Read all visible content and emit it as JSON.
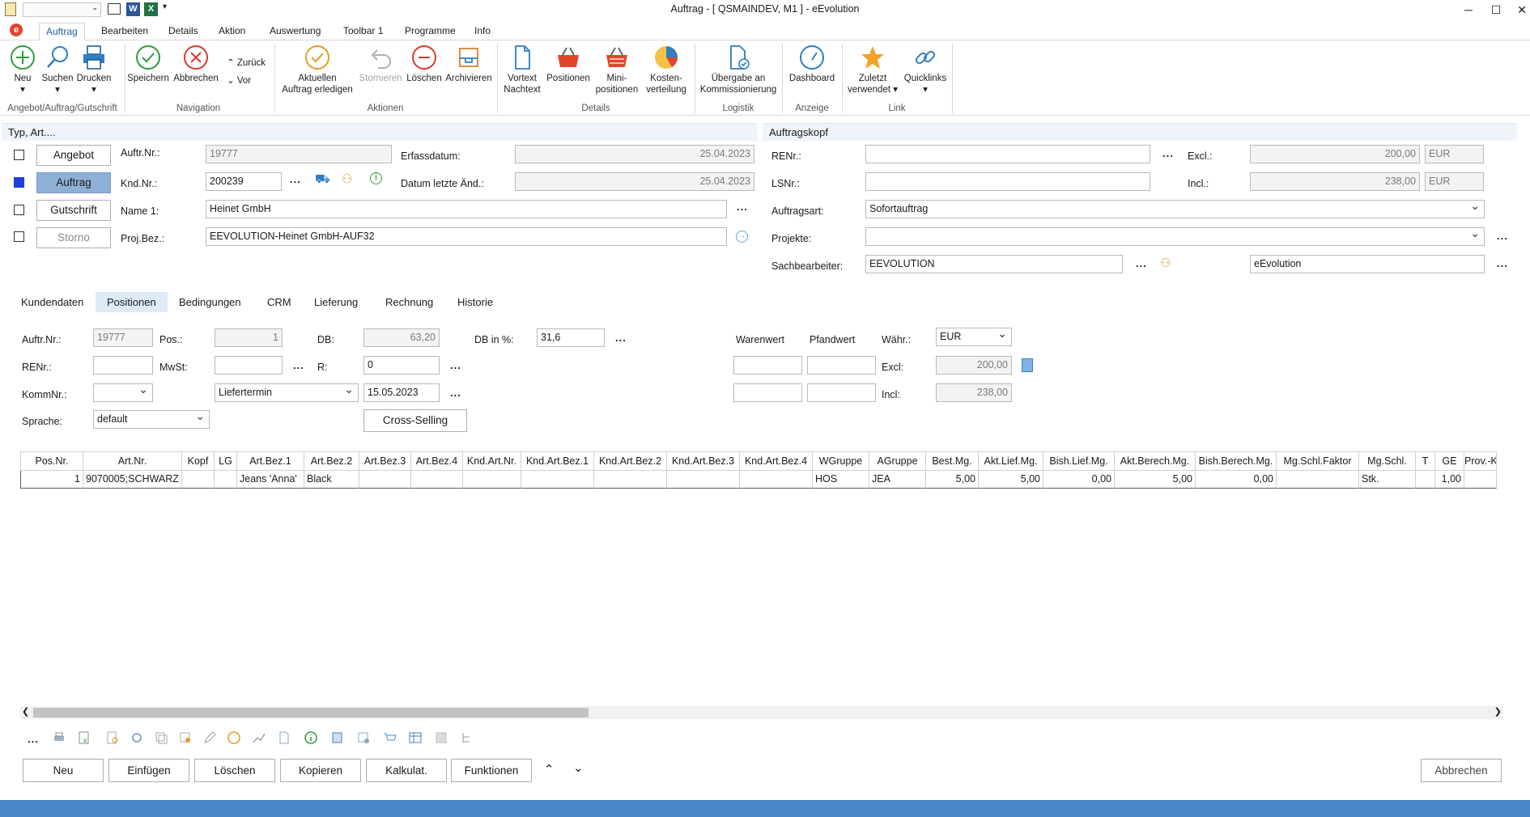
{
  "window": {
    "title": "Auftrag - [ QSMAINDEV, M1 ]  -  eEvolution",
    "minimize": "─",
    "maximize": "☐",
    "close": "✕"
  },
  "ribbon_tabs": [
    "Auftrag",
    "Bearbeiten",
    "Details",
    "Aktion",
    "Auswertung",
    "Toolbar 1",
    "Programme",
    "Info"
  ],
  "ribbon": {
    "neu": "Neu",
    "suchen": "Suchen",
    "drucken": "Drucken",
    "group_angebot": "Angebot/Auftrag/Gutschrift",
    "speichern": "Speichern",
    "abbrechen": "Abbrechen",
    "zurueck": "Zurück",
    "vor": "Vor",
    "group_navigation": "Navigation",
    "aktuellen_line1": "Aktuellen",
    "aktuellen_line2": "Auftrag erledigen",
    "stornieren": "Stornieren",
    "loeschen": "Löschen",
    "archivieren": "Archivieren",
    "group_aktionen": "Aktionen",
    "vortext_line1": "Vortext",
    "vortext_line2": "Nachtext",
    "positionen": "Positionen",
    "mini_line1": "Mini-",
    "mini_line2": "positionen",
    "kosten_line1": "Kosten-",
    "kosten_line2": "verteilung",
    "group_details": "Details",
    "uebergabe_line1": "Übergabe an",
    "uebergabe_line2": "Kommissionierung",
    "group_logistik": "Logistik",
    "dashboard": "Dashboard",
    "group_anzeige": "Anzeige",
    "zuletzt_line1": "Zuletzt",
    "zuletzt_line2": "verwendet",
    "quicklinks": "Quicklinks",
    "group_link": "Link"
  },
  "typ_section": {
    "header": "Typ, Art....",
    "angebot": "Angebot",
    "auftrag": "Auftrag",
    "gutschrift": "Gutschrift",
    "storno": "Storno",
    "auftr_nr_label": "Auftr.Nr.:",
    "auftr_nr": "19777",
    "knd_nr_label": "Knd.Nr.:",
    "knd_nr": "200239",
    "name1_label": "Name 1:",
    "name1": "Heinet GmbH",
    "projbez_label": "Proj.Bez.:",
    "projbez": "EEVOLUTION-Heinet GmbH-AUF32",
    "erfassdatum_label": "Erfassdatum:",
    "erfassdatum": "25.04.2023",
    "letzte_aend_label": "Datum letzte Änd.:",
    "letzte_aend": "25.04.2023",
    "ellipsis": "..."
  },
  "kopf_section": {
    "header": "Auftragskopf",
    "renr_label": "RENr.:",
    "renr": "",
    "lsnr_label": "LSNr.:",
    "lsnr": "",
    "excl_label": "Excl.:",
    "excl": "200,00",
    "incl_label": "Incl.:",
    "incl": "238,00",
    "currency": "EUR",
    "auftragsart_label": "Auftragsart:",
    "auftragsart": "Sofortauftrag",
    "projekte_label": "Projekte:",
    "projekte": "",
    "sachbearbeiter_label": "Sachbearbeiter:",
    "sachbearbeiter": "EEVOLUTION",
    "sachbearbeiter_name": "eEvolution"
  },
  "tabs": [
    "Kundendaten",
    "Positionen",
    "Bedingungen",
    "CRM",
    "Lieferung",
    "Rechnung",
    "Historie"
  ],
  "positionen": {
    "auftr_nr_label": "Auftr.Nr.:",
    "auftr_nr": "19777",
    "pos_label": "Pos.:",
    "pos": "1",
    "db_label": "DB:",
    "db": "63,20",
    "db_pct_label": "DB in %:",
    "db_pct": "31,6",
    "renr_label": "RENr.:",
    "mwst_label": "MwSt:",
    "r_label": "R:",
    "r": "0",
    "kommnr_label": "KommNr.:",
    "liefertermin": "Liefertermin",
    "liefertermin_date": "15.05.2023",
    "sprache_label": "Sprache:",
    "sprache": "default",
    "cross_selling": "Cross-Selling",
    "warenwert_label": "Warenwert",
    "pfandwert_label": "Pfandwert",
    "waehr_label": "Währ.:",
    "waehr": "EUR",
    "excl_label": "Excl:",
    "excl": "200,00",
    "incl_label": "Incl:",
    "incl": "238,00",
    "ellipsis": "..."
  },
  "grid": {
    "columns": [
      "Pos.Nr.",
      "Art.Nr.",
      "Kopf",
      "LG",
      "Art.Bez.1",
      "Art.Bez.2",
      "Art.Bez.3",
      "Art.Bez.4",
      "Knd.Art.Nr.",
      "Knd.Art.Bez.1",
      "Knd.Art.Bez.2",
      "Knd.Art.Bez.3",
      "Knd.Art.Bez.4",
      "WGruppe",
      "AGruppe",
      "Best.Mg.",
      "Akt.Lief.Mg.",
      "Bish.Lief.Mg.",
      "Akt.Berech.Mg.",
      "Bish.Berech.Mg.",
      "Mg.Schl.Faktor",
      "Mg.Schl.",
      "T",
      "GE",
      "Prov.-K"
    ],
    "rows": [
      [
        "1",
        "9070005;SCHWARZ",
        "",
        "",
        "Jeans 'Anna'",
        "Black",
        "",
        "",
        "",
        "",
        "",
        "",
        "",
        "HOS",
        "JEA",
        "5,00",
        "5,00",
        "0,00",
        "5,00",
        "0,00",
        "",
        "Stk.",
        "",
        "1,00",
        ""
      ]
    ]
  },
  "toolbar_dots": "...",
  "bottom_buttons": {
    "neu": "Neu",
    "einfuegen": "Einfügen",
    "loeschen": "Löschen",
    "kopieren": "Kopieren",
    "kalkulat": "Kalkulat.",
    "funktionen": "Funktionen",
    "abbrechen": "Abbrechen"
  }
}
